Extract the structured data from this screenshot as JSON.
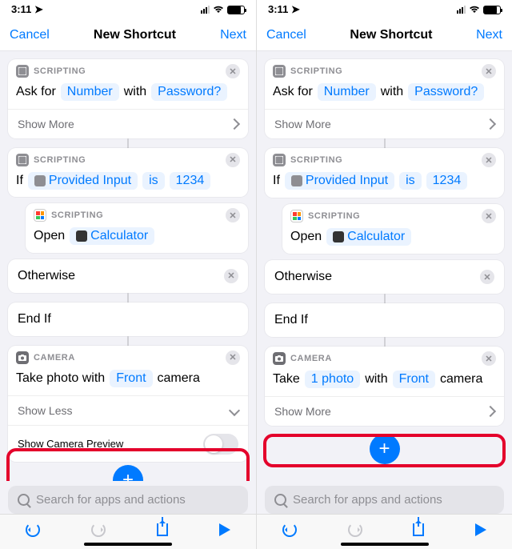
{
  "statusbar": {
    "time": "3:11",
    "loc_arrow": "⤴"
  },
  "nav": {
    "cancel": "Cancel",
    "title": "New Shortcut",
    "next": "Next"
  },
  "categories": {
    "scripting": "SCRIPTING",
    "camera": "CAMERA"
  },
  "left": {
    "ask": {
      "pre": "Ask for",
      "t1": "Number",
      "mid": "with",
      "t2": "Password?"
    },
    "show_more": "Show More",
    "if": {
      "pre": "If",
      "t1": "Provided Input",
      "mid": "is",
      "t2": "1234"
    },
    "open": {
      "pre": "Open",
      "t1": "Calculator"
    },
    "otherwise": "Otherwise",
    "endif": "End If",
    "cam": {
      "w1": "Take photo with",
      "t1": "Front",
      "w2": "camera"
    },
    "show_less": "Show Less",
    "toggle_label": "Show Camera Preview"
  },
  "right": {
    "cam": {
      "w1": "Take",
      "t1": "1 photo",
      "w2": "with",
      "t2": "Front",
      "w3": "camera"
    },
    "show_more": "Show More"
  },
  "search_placeholder": "Search for apps and actions"
}
